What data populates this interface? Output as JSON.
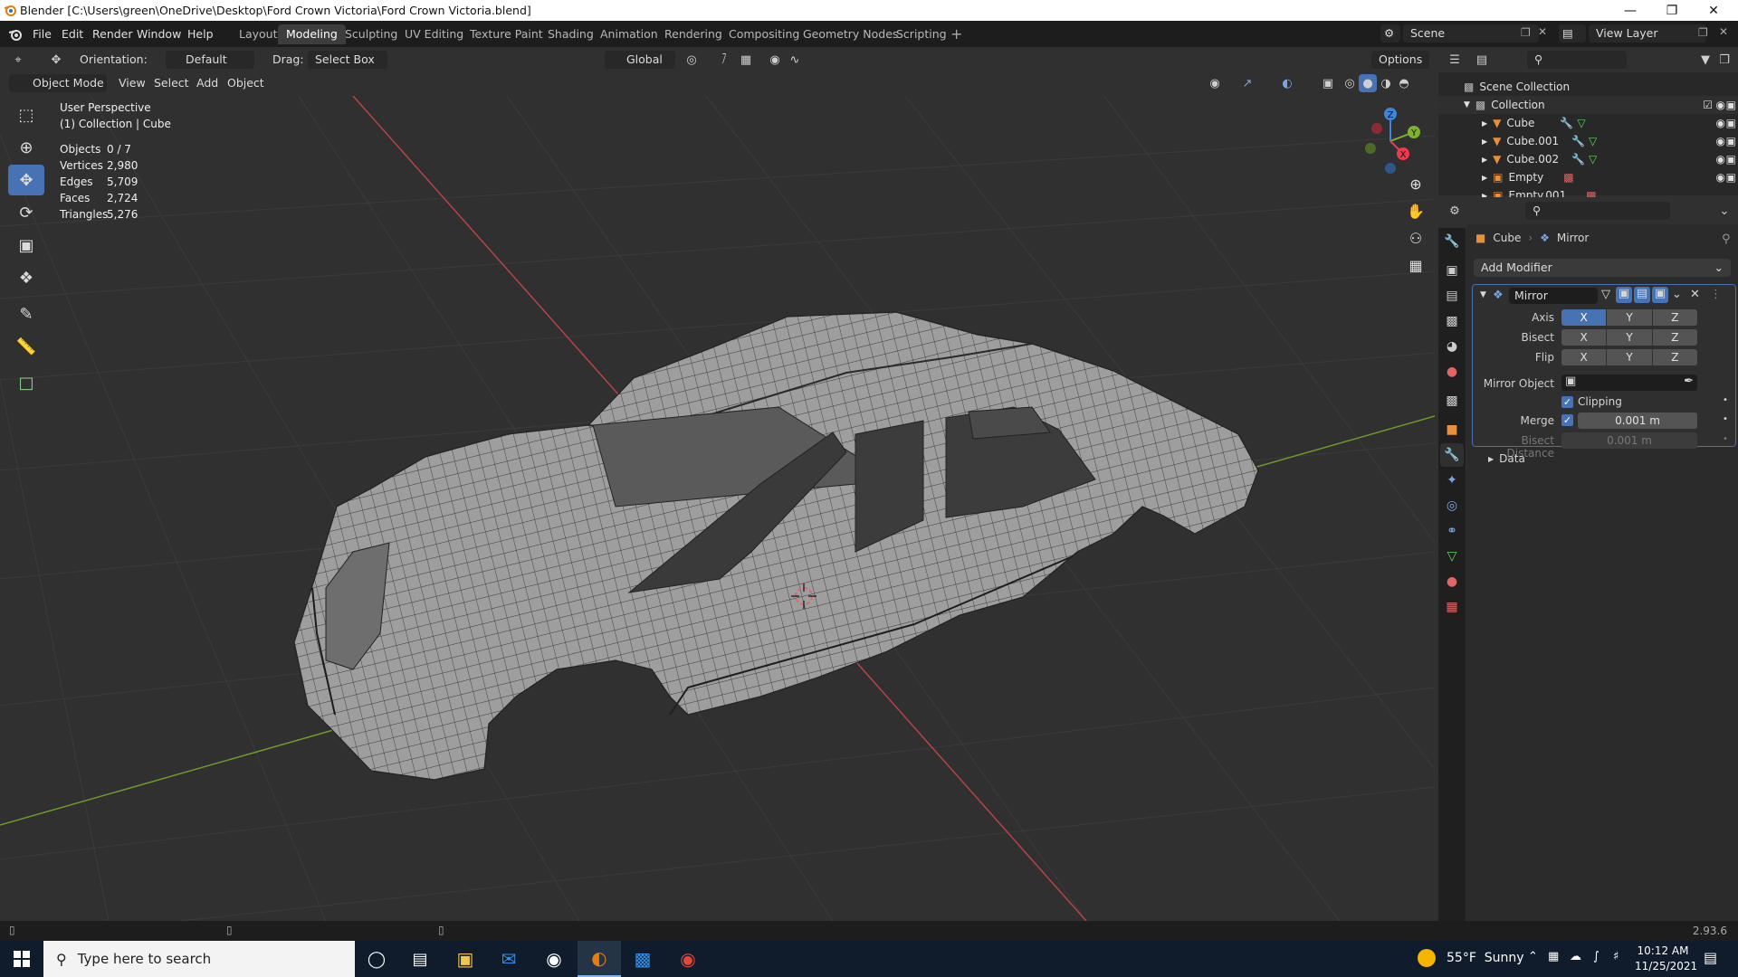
{
  "window": {
    "title": "Blender [C:\\Users\\green\\OneDrive\\Desktop\\Ford Crown Victoria\\Ford Crown Victoria.blend]",
    "controls": [
      "minimize-icon",
      "maximize-icon",
      "close-icon"
    ]
  },
  "menus": [
    "File",
    "Edit",
    "Render",
    "Window",
    "Help"
  ],
  "workspaces": [
    "Layout",
    "Modeling",
    "Sculpting",
    "UV Editing",
    "Texture Paint",
    "Shading",
    "Animation",
    "Rendering",
    "Compositing",
    "Geometry Nodes",
    "Scripting"
  ],
  "active_workspace": "Modeling",
  "scene": {
    "name": "Scene",
    "view_layer": "View Layer"
  },
  "tool_header": {
    "orientation_label": "Orientation:",
    "orientation_value": "Default",
    "drag_label": "Drag:",
    "drag_value": "Select Box",
    "transform_space": "Global",
    "options": "Options"
  },
  "view_header": {
    "mode": "Object Mode",
    "menus": [
      "View",
      "Select",
      "Add",
      "Object"
    ]
  },
  "viewport": {
    "perspective": "User Perspective",
    "collection": "(1) Collection | Cube",
    "stats": [
      {
        "label": "Objects",
        "value": "0 / 7"
      },
      {
        "label": "Vertices",
        "value": "2,980"
      },
      {
        "label": "Edges",
        "value": "5,709"
      },
      {
        "label": "Faces",
        "value": "2,724"
      },
      {
        "label": "Triangles",
        "value": "5,276"
      }
    ],
    "gizmo_axes": [
      "X",
      "Y",
      "Z"
    ]
  },
  "outliner": {
    "root": "Scene Collection",
    "collection": "Collection",
    "items": [
      "Cube",
      "Cube.001",
      "Cube.002",
      "Empty",
      "Empty.001"
    ]
  },
  "properties": {
    "breadcrumb_object": "Cube",
    "breadcrumb_modifier": "Mirror",
    "add_modifier": "Add Modifier",
    "modifier_name": "Mirror",
    "axis_label": "Axis",
    "bisect_label": "Bisect",
    "flip_label": "Flip",
    "axis_letters": [
      "X",
      "Y",
      "Z"
    ],
    "mirror_object_label": "Mirror Object",
    "clipping_label": "Clipping",
    "merge_label": "Merge",
    "merge_value": "0.001 m",
    "bisect_distance_label": "Bisect Distance",
    "bisect_distance_value": "0.001 m",
    "data_label": "Data"
  },
  "status": {
    "version": "2.93.6"
  },
  "taskbar": {
    "search_placeholder": "Type here to search",
    "weather": "55°F  Sunny",
    "time": "10:12 AM",
    "date": "11/25/2021"
  },
  "colors": {
    "accent": "#4772b3",
    "axis_x": "#ee3a4f",
    "axis_y": "#7cb32a",
    "axis_z": "#3f85d8",
    "viewport_bg": "#303030",
    "object_orange": "#e8903b"
  }
}
